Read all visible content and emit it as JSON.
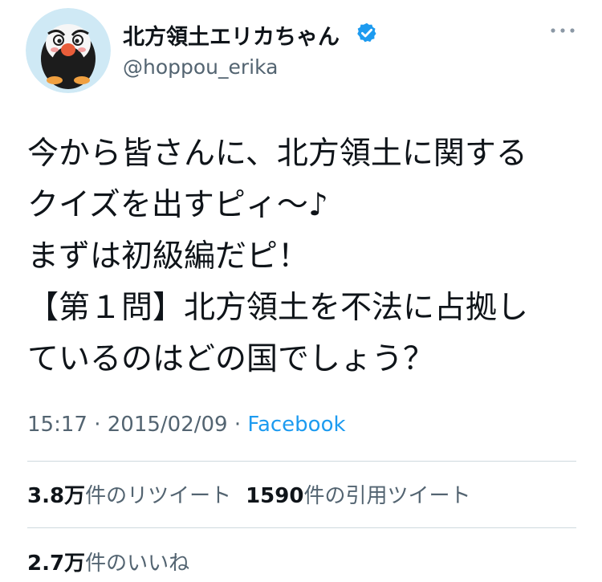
{
  "profile": {
    "display_name": "北方領土エリカちゃん",
    "handle": "@hoppou_erika",
    "verified": true
  },
  "tweet": {
    "text": "今から皆さんに、北方領土に関する\nクイズを出すピィ～♪\nまずは初級編だピ！\n【第１問】北方領土を不法に占拠し\nているのはどの国でしょう？",
    "time": "15:17",
    "date": "2015/02/09",
    "separator": " · ",
    "source": "Facebook"
  },
  "stats": {
    "retweets_count": "3.8万",
    "retweets_label": "件のリツイート",
    "quotes_count": "1590",
    "quotes_label": "件の引用ツイート",
    "likes_count": "2.7万",
    "likes_label": "件のいいね"
  },
  "icons": {
    "verified": "verified-badge-icon",
    "more": "more-horizontal-icon"
  },
  "colors": {
    "text": "#0f1419",
    "secondary": "#536471",
    "accent": "#1d9bf0",
    "divider": "#cfd9de"
  }
}
